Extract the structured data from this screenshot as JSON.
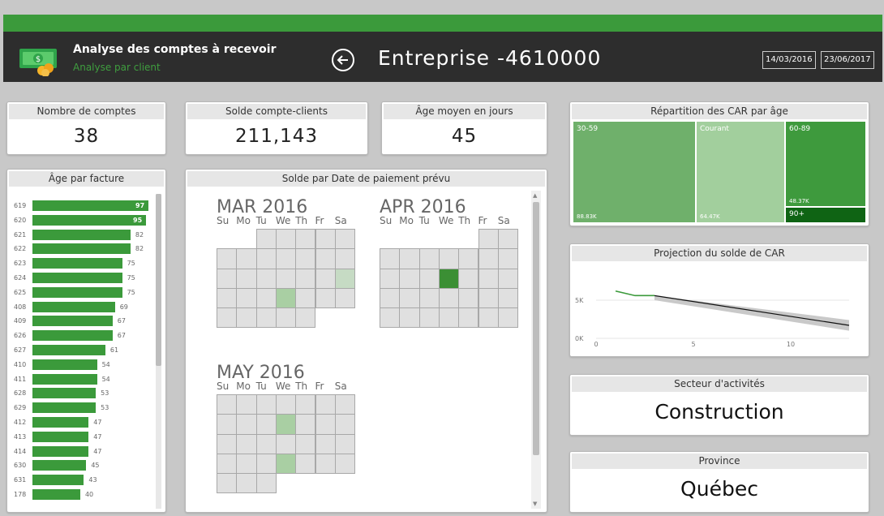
{
  "header": {
    "title": "Analyse des comptes à recevoir",
    "subtitle": "Analyse par client",
    "company": "Entreprise -4610000",
    "date_start": "14/03/2016",
    "date_end": "23/06/2017"
  },
  "kpis": {
    "accounts": {
      "label": "Nombre de comptes",
      "value": "38"
    },
    "balance": {
      "label": "Solde compte-clients",
      "value": "211,143"
    },
    "avg_age": {
      "label": "Âge moyen en jours",
      "value": "45"
    }
  },
  "age_by_invoice": {
    "title": "Âge par facture",
    "rows": [
      {
        "id": "619",
        "v": 97
      },
      {
        "id": "620",
        "v": 95
      },
      {
        "id": "621",
        "v": 82
      },
      {
        "id": "622",
        "v": 82
      },
      {
        "id": "623",
        "v": 75
      },
      {
        "id": "624",
        "v": 75
      },
      {
        "id": "625",
        "v": 75
      },
      {
        "id": "408",
        "v": 69
      },
      {
        "id": "409",
        "v": 67
      },
      {
        "id": "626",
        "v": 67
      },
      {
        "id": "627",
        "v": 61
      },
      {
        "id": "410",
        "v": 54
      },
      {
        "id": "411",
        "v": 54
      },
      {
        "id": "628",
        "v": 53
      },
      {
        "id": "629",
        "v": 53
      },
      {
        "id": "412",
        "v": 47
      },
      {
        "id": "413",
        "v": 47
      },
      {
        "id": "414",
        "v": 47
      },
      {
        "id": "630",
        "v": 45
      },
      {
        "id": "631",
        "v": 43
      },
      {
        "id": "178",
        "v": 40
      }
    ]
  },
  "calendar": {
    "title": "Solde par Date de paiement prévu",
    "dow": [
      "Su",
      "Mo",
      "Tu",
      "We",
      "Th",
      "Fr",
      "Sa"
    ],
    "months": [
      {
        "name": "MAR 2016",
        "offset": 2,
        "days": 31,
        "light": [
          23
        ],
        "vlight": [
          19
        ],
        "dark": []
      },
      {
        "name": "APR 2016",
        "offset": 5,
        "days": 30,
        "light": [],
        "vlight": [],
        "dark": [
          13
        ]
      },
      {
        "name": "MAY 2016",
        "offset": 0,
        "days": 31,
        "light": [
          11,
          25
        ],
        "vlight": [],
        "dark": []
      }
    ]
  },
  "treemap": {
    "title": "Répartition des CAR par âge",
    "cells": [
      {
        "name": "30-59",
        "value": "88.83K",
        "color": "#6fb06b"
      },
      {
        "name": "Courant",
        "value": "64.47K",
        "color": "#a2cf9d"
      },
      {
        "name": "60-89",
        "value": "48.37K",
        "color": "#3e9a3d"
      },
      {
        "name": "90+",
        "value": "",
        "color": "#0f6414"
      }
    ]
  },
  "projection": {
    "title": "Projection du solde de CAR",
    "chart_data": {
      "type": "line",
      "x_ticks": [
        "0",
        "5",
        "10"
      ],
      "y_ticks": [
        "0K",
        "5K"
      ],
      "xlim": [
        0,
        13
      ],
      "ylim": [
        0,
        10
      ],
      "actual": {
        "x": [
          1,
          2,
          3
        ],
        "y": [
          6.2,
          5.6,
          5.6
        ]
      },
      "forecast": {
        "x": [
          3,
          13
        ],
        "y": [
          5.6,
          1.7
        ]
      },
      "band_upper": {
        "x": [
          3,
          13
        ],
        "y": [
          5.6,
          2.4
        ]
      },
      "band_lower": {
        "x": [
          3,
          13
        ],
        "y": [
          5.0,
          1.0
        ]
      },
      "actual_color": "#3b9a3b",
      "forecast_color": "#111111"
    }
  },
  "sector": {
    "label": "Secteur d'activités",
    "value": "Construction"
  },
  "province": {
    "label": "Province",
    "value": "Québec"
  },
  "colors": {
    "green": "#3b9a3b",
    "dark": "#2d2d2d"
  }
}
